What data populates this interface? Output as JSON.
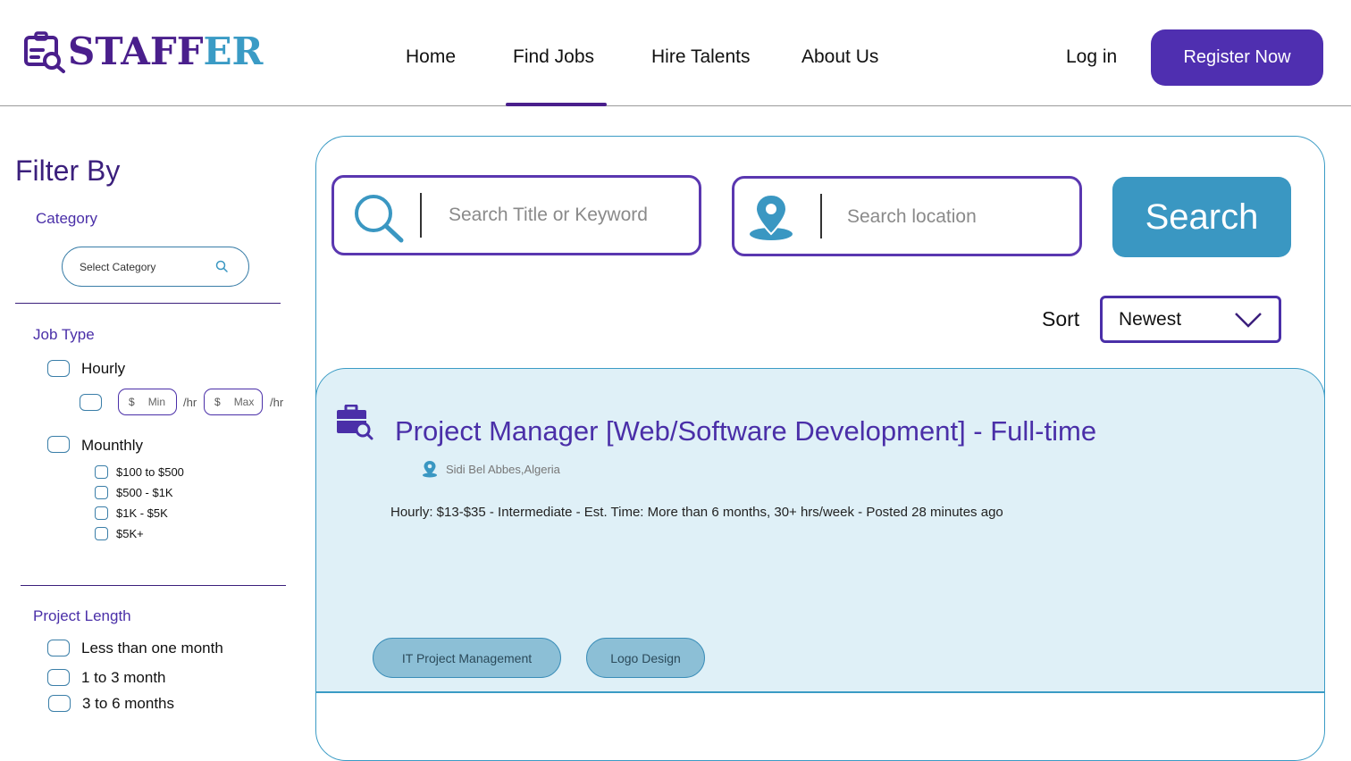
{
  "brand": {
    "part1": "STAFF",
    "part2": "ER"
  },
  "nav": {
    "items": [
      "Home",
      "Find Jobs",
      "Hire Talents",
      "About Us"
    ],
    "active": "Find Jobs",
    "login": "Log in",
    "register": "Register Now"
  },
  "sidebar": {
    "title": "Filter By",
    "category": {
      "label": "Category",
      "placeholder": "Select Category"
    },
    "job_type": {
      "label": "Job Type",
      "hourly": "Hourly",
      "rate_currency": "$",
      "min_placeholder": "Min",
      "max_placeholder": "Max",
      "per_unit": "/hr",
      "monthly": "Mounthly",
      "monthly_ranges": [
        "$100 to $500",
        "$500 - $1K",
        "$1K - $5K",
        "$5K+"
      ]
    },
    "project_length": {
      "label": "Project Length",
      "options": [
        "Less than one month",
        "1 to 3 month",
        "3 to 6 months"
      ]
    }
  },
  "search": {
    "keyword_placeholder": "Search Title or Keyword",
    "location_placeholder": "Search location",
    "button": "Search"
  },
  "sort": {
    "label": "Sort",
    "value": "Newest"
  },
  "job": {
    "title": "Project Manager [Web/Software Development] - Full-time",
    "location": "Sidi Bel Abbes,Algeria",
    "meta": "Hourly: $13-$35 - Intermediate - Est. Time: More than 6 months, 30+ hrs/week - Posted 28 minutes ago",
    "tags": [
      "IT Project Management",
      "Logo Design"
    ]
  },
  "colors": {
    "primary": "#4f2fb0",
    "accent": "#3a97c2",
    "card_bg": "#dff0f7"
  }
}
